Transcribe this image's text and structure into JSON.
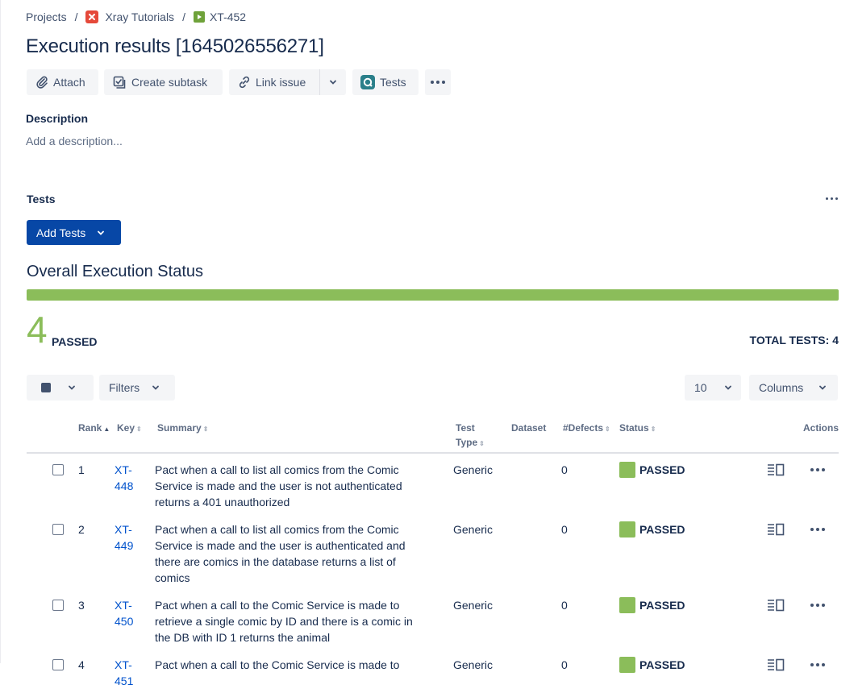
{
  "breadcrumb": {
    "projects": "Projects",
    "project": "Xray Tutorials",
    "issue": "XT-452",
    "sep": "/"
  },
  "page_title": "Execution results [1645026556271]",
  "toolbar": {
    "attach": "Attach",
    "create_subtask": "Create subtask",
    "link_issue": "Link issue",
    "tests": "Tests"
  },
  "description": {
    "label": "Description",
    "placeholder": "Add a description..."
  },
  "tests_section": {
    "label": "Tests",
    "add_tests": "Add Tests"
  },
  "overall": {
    "title": "Overall Execution Status",
    "passed_count": "4",
    "passed_label": "PASSED",
    "passed_fraction": 1.0,
    "total": "TOTAL TESTS: 4"
  },
  "controls": {
    "filters": "Filters",
    "page_size": "10",
    "columns": "Columns"
  },
  "table": {
    "headers": {
      "rank": "Rank",
      "key": "Key",
      "summary": "Summary",
      "test_type_1": "Test",
      "test_type_2": "Type",
      "dataset": "Dataset",
      "defects": "#Defects",
      "status": "Status",
      "actions": "Actions"
    },
    "rows": [
      {
        "rank": "1",
        "key_1": "XT-",
        "key_2": "448",
        "summary": [
          "Pact when a call to list all comics from the Comic",
          "Service is made and the user is not authenticated",
          "returns a 401 unauthorized"
        ],
        "type": "Generic",
        "defects": "0",
        "status": "PASSED"
      },
      {
        "rank": "2",
        "key_1": "XT-",
        "key_2": "449",
        "summary": [
          "Pact when a call to list all comics from the Comic",
          "Service is made and the user is authenticated and",
          "there are comics in the database returns a list of",
          "comics"
        ],
        "type": "Generic",
        "defects": "0",
        "status": "PASSED"
      },
      {
        "rank": "3",
        "key_1": "XT-",
        "key_2": "450",
        "summary": [
          "Pact when a call to the Comic Service is made to",
          "retrieve a single comic by ID and there is a comic in",
          "the DB with ID 1 returns the animal"
        ],
        "type": "Generic",
        "defects": "0",
        "status": "PASSED"
      },
      {
        "rank": "4",
        "key_1": "XT-",
        "key_2": "451",
        "summary": [
          "Pact when a call to the Comic Service is made to"
        ],
        "type": "Generic",
        "defects": "0",
        "status": "PASSED"
      }
    ]
  },
  "colors": {
    "passed": "#8bbd5a",
    "primary": "#0747a6",
    "link": "#0052cc"
  }
}
